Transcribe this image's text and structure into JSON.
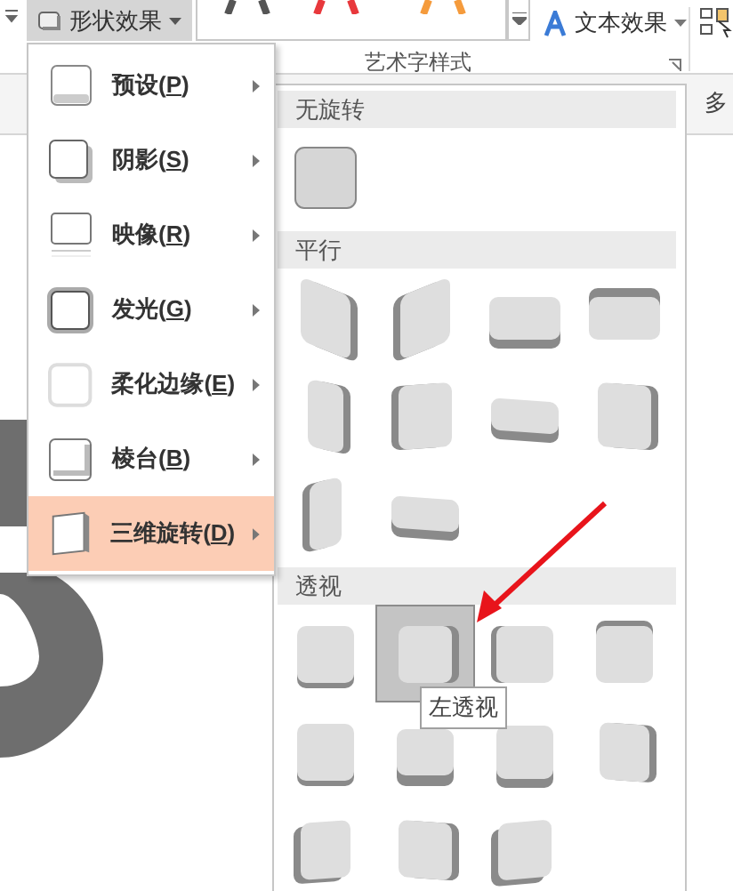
{
  "ribbon": {
    "shape_effects_button": {
      "label": "形状效果",
      "expanded": true
    },
    "text_effects_button": {
      "label": "文本效果"
    },
    "group_label": "艺术字样式",
    "cut_label": "多"
  },
  "menu": {
    "items": [
      {
        "kind": "preset",
        "text_before": "预设(",
        "access_key": "P",
        "text_after": ")",
        "selected": false
      },
      {
        "kind": "shadow",
        "text_before": "阴影(",
        "access_key": "S",
        "text_after": ")",
        "selected": false
      },
      {
        "kind": "reflection",
        "text_before": "映像(",
        "access_key": "R",
        "text_after": ")",
        "selected": false
      },
      {
        "kind": "glow",
        "text_before": "发光(",
        "access_key": "G",
        "text_after": ")",
        "selected": false
      },
      {
        "kind": "soft-edges",
        "text_before": "柔化边缘(",
        "access_key": "E",
        "text_after": ")",
        "selected": false
      },
      {
        "kind": "bevel",
        "text_before": "棱台(",
        "access_key": "B",
        "text_after": ")",
        "selected": false
      },
      {
        "kind": "rotation",
        "text_before": "三维旋转(",
        "access_key": "D",
        "text_after": ")",
        "selected": true
      }
    ]
  },
  "submenu": {
    "sections": [
      {
        "title": "无旋转",
        "items": [
          {
            "selected": false
          }
        ]
      },
      {
        "title": "平行",
        "items": [
          {
            "selected": false
          },
          {
            "selected": false
          },
          {
            "selected": false
          },
          {
            "selected": false
          },
          {
            "selected": false
          },
          {
            "selected": false
          },
          {
            "selected": false
          },
          {
            "selected": false
          },
          {
            "selected": false
          },
          {
            "selected": false
          }
        ]
      },
      {
        "title": "透视",
        "items": [
          {
            "selected": false
          },
          {
            "selected": true
          },
          {
            "selected": false
          },
          {
            "selected": false
          },
          {
            "selected": false
          },
          {
            "selected": false
          },
          {
            "selected": false
          },
          {
            "selected": false
          },
          {
            "selected": false
          },
          {
            "selected": false
          },
          {
            "selected": false
          }
        ]
      }
    ]
  },
  "tooltip": "左透视"
}
